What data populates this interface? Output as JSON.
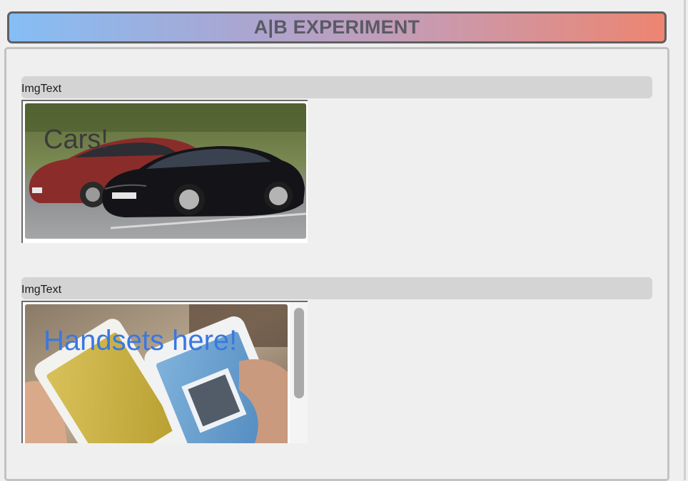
{
  "header": {
    "title": "A|B EXPERIMENT"
  },
  "sections": [
    {
      "label": "ImgText",
      "caption": "Cars!",
      "caption_color": "#3b3b3b",
      "image_subject": "cars-photo"
    },
    {
      "label": "ImgText",
      "caption": "Handsets here!",
      "caption_color": "#3a78e0",
      "image_subject": "phones-photo"
    }
  ]
}
